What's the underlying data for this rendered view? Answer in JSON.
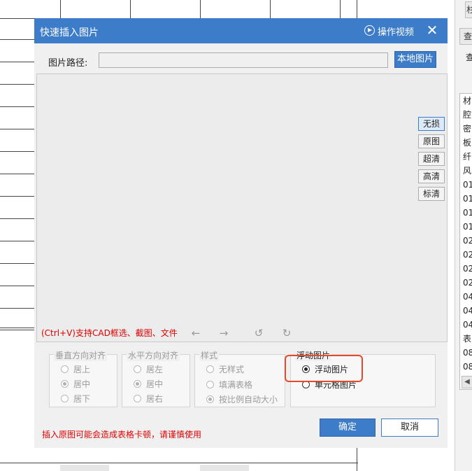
{
  "dialog": {
    "title": "快速插入图片",
    "video_link": "操作视频",
    "close_icon": "close-icon",
    "path_label": "图片路径:",
    "path_value": "",
    "local_button": "本地图片",
    "quality_buttons": [
      {
        "label": "无损",
        "selected": true
      },
      {
        "label": "原图",
        "selected": false
      },
      {
        "label": "超清",
        "selected": false
      },
      {
        "label": "高清",
        "selected": false
      },
      {
        "label": "标清",
        "selected": false
      }
    ],
    "hint": "(Ctrl+V)支持CAD框选、截图、文件",
    "toolbar_icons": [
      "arrow-left-icon",
      "arrow-right-icon",
      "rotate-left-icon",
      "rotate-right-icon"
    ],
    "vertical_align": {
      "title": "垂直方向对齐",
      "options": [
        "居上",
        "居中",
        "居下"
      ],
      "selected": "居中"
    },
    "horizontal_align": {
      "title": "水平方向对齐",
      "options": [
        "居左",
        "居中",
        "居右"
      ],
      "selected": "居中"
    },
    "style": {
      "title": "样式",
      "options": [
        "无样式",
        "填满表格",
        "按比例自动大小"
      ],
      "selected": "按比例自动大小"
    },
    "float": {
      "title": "浮动图片",
      "options": [
        "浮动图片",
        "单元格图片"
      ],
      "selected": "浮动图片"
    },
    "warning": "插入原图可能会造成表格卡顿，请谨慎使用",
    "ok_button": "确定",
    "cancel_button": "取消"
  },
  "right_panel": {
    "top_chars": [
      "杉",
      "查",
      "查"
    ],
    "list_items": [
      "材",
      "腔",
      "密",
      "板",
      "纤",
      "风",
      "01",
      "01",
      "01",
      "01",
      "02",
      "02",
      "02",
      "02",
      "04",
      "04",
      "04",
      "表",
      "08",
      "08"
    ]
  },
  "colors": {
    "title_bar": "#3d7cc9",
    "warning_red": "#e00000",
    "highlight": "#e54a2c"
  }
}
